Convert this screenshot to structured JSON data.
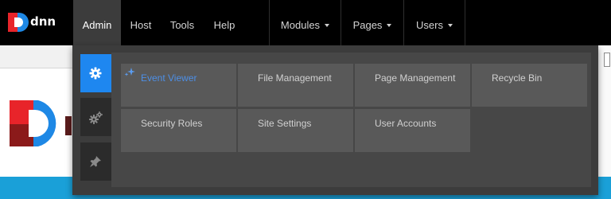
{
  "brand": {
    "name": "dnn"
  },
  "nav": {
    "items": [
      {
        "label": "Admin",
        "active": true,
        "dropdown": false
      },
      {
        "label": "Host",
        "active": false,
        "dropdown": false
      },
      {
        "label": "Tools",
        "active": false,
        "dropdown": false
      },
      {
        "label": "Help",
        "active": false,
        "dropdown": false
      },
      {
        "label": "Modules",
        "active": false,
        "dropdown": true
      },
      {
        "label": "Pages",
        "active": false,
        "dropdown": true
      },
      {
        "label": "Users",
        "active": false,
        "dropdown": true
      }
    ]
  },
  "admin_menu": {
    "side_tabs": [
      {
        "icon": "gear-icon",
        "active": true
      },
      {
        "icon": "gears-icon",
        "active": false
      },
      {
        "icon": "pin-icon",
        "active": false
      }
    ],
    "tiles": [
      {
        "label": "Event Viewer",
        "active": true
      },
      {
        "label": "File Management",
        "active": false
      },
      {
        "label": "Page Management",
        "active": false
      },
      {
        "label": "Recycle Bin",
        "active": false
      },
      {
        "label": "Security Roles",
        "active": false
      },
      {
        "label": "Site Settings",
        "active": false
      },
      {
        "label": "User Accounts",
        "active": false
      }
    ]
  },
  "colors": {
    "accent": "#1e87f0",
    "active_text": "#4d8fe6",
    "topbar": "#000000",
    "panel": "#3c3c3c",
    "tile": "#595959",
    "brand_red": "#e8242a",
    "brand_blue": "#1e88e5",
    "page_blue": "#1aa0d8"
  }
}
